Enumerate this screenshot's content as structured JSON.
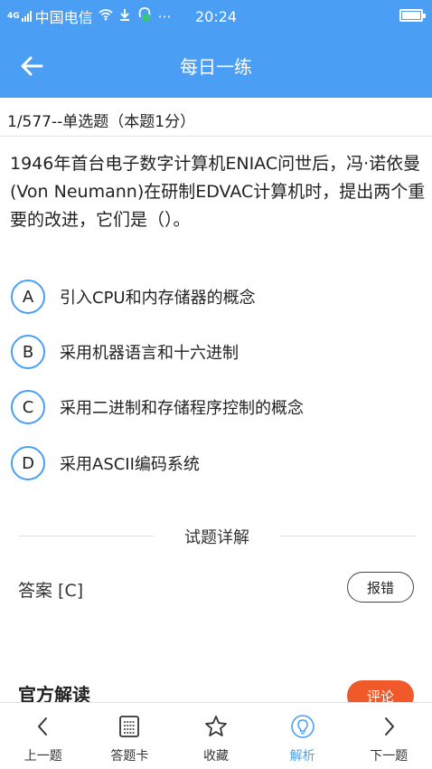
{
  "status_bar": {
    "network": "4G",
    "carrier": "中国电信",
    "time": "20:24"
  },
  "app_bar": {
    "title": "每日一练"
  },
  "question_meta": "1/577--单选题（本题1分）",
  "question_text": "1946年首台电子数字计算机ENIAC问世后，冯·诺依曼(Von Neumann)在研制EDVAC计算机时，提出两个重要的改进，它们是（）。",
  "options": [
    {
      "letter": "A",
      "text": "引入CPU和内存储器的概念"
    },
    {
      "letter": "B",
      "text": "采用机器语言和十六进制"
    },
    {
      "letter": "C",
      "text": "采用二进制和存储程序控制的概念"
    },
    {
      "letter": "D",
      "text": "采用ASCII编码系统"
    }
  ],
  "detail_section_title": "试题详解",
  "answer_text": "答案 [C]",
  "report_label": "报错",
  "official_title": "官方解读",
  "comment_label": "评论",
  "bottom_nav": [
    {
      "label": "上一题",
      "icon": "chevron-left-icon"
    },
    {
      "label": "答题卡",
      "icon": "answer-card-icon"
    },
    {
      "label": "收藏",
      "icon": "star-icon"
    },
    {
      "label": "解析",
      "icon": "lightbulb-icon",
      "active": true
    },
    {
      "label": "下一题",
      "icon": "chevron-right-icon"
    }
  ],
  "colors": {
    "primary": "#4a9ff5",
    "comment_button": "#f05a2a"
  }
}
